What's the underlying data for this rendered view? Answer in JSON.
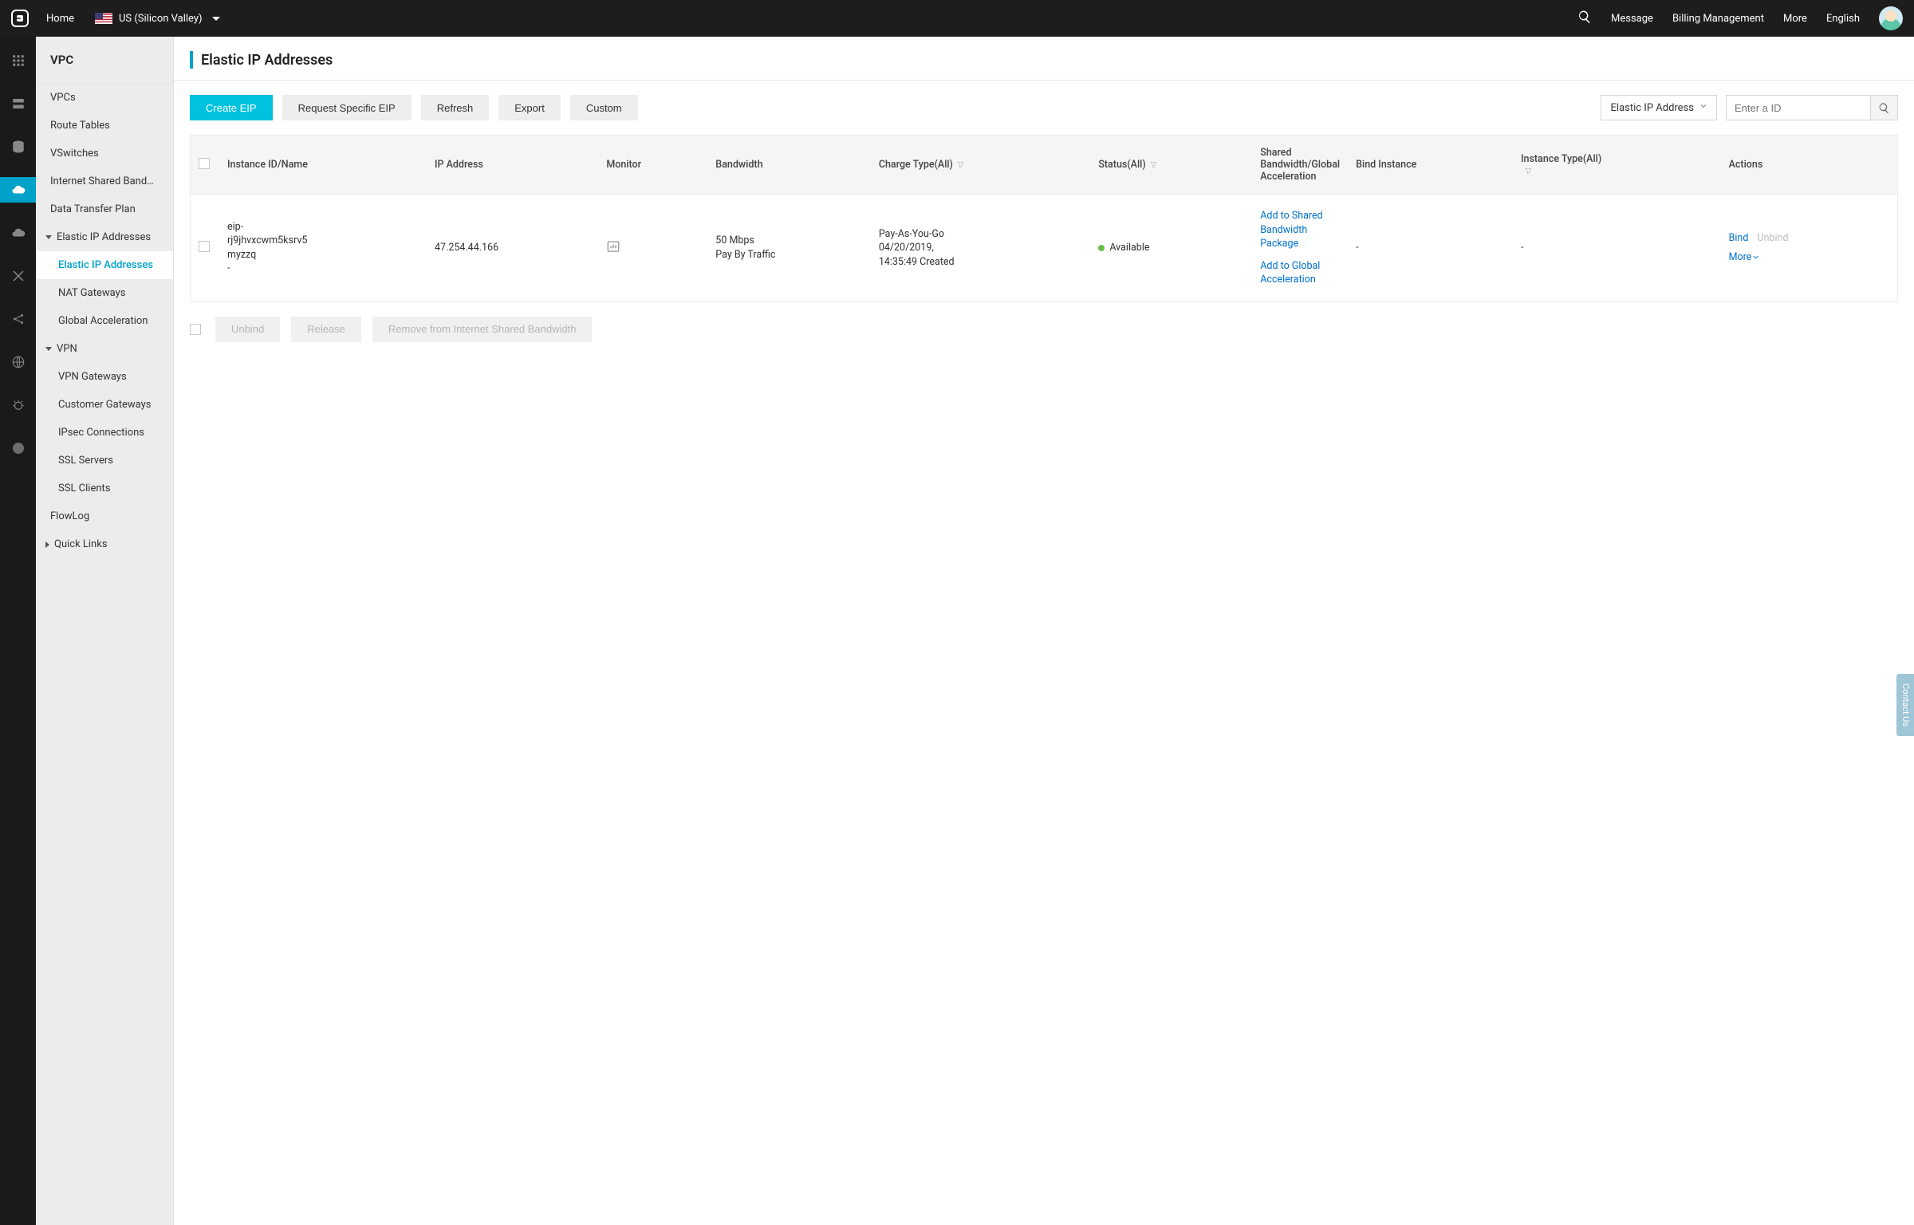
{
  "topbar": {
    "home": "Home",
    "region": "US (Silicon Valley)",
    "links": {
      "message": "Message",
      "billing": "Billing Management",
      "more": "More",
      "lang": "English"
    }
  },
  "sidebar": {
    "title": "VPC",
    "items": [
      "VPCs",
      "Route Tables",
      "VSwitches",
      "Internet Shared Band…",
      "Data Transfer Plan"
    ],
    "eip_group": "Elastic IP Addresses",
    "eip_items": [
      "Elastic IP Addresses",
      "NAT Gateways",
      "Global Acceleration"
    ],
    "vpn_group": "VPN",
    "vpn_items": [
      "VPN Gateways",
      "Customer Gateways",
      "IPsec Connections",
      "SSL Servers",
      "SSL Clients"
    ],
    "flowlog": "FlowLog",
    "quick": "Quick Links"
  },
  "page": {
    "title": "Elastic IP Addresses",
    "buttons": {
      "create": "Create EIP",
      "request": "Request Specific EIP",
      "refresh": "Refresh",
      "export": "Export",
      "custom": "Custom"
    },
    "filter_label": "Elastic IP Address",
    "search_placeholder": "Enter a ID"
  },
  "table": {
    "headers": {
      "instance": "Instance ID/Name",
      "ip": "IP Address",
      "monitor": "Monitor",
      "bandwidth": "Bandwidth",
      "charge": "Charge Type(All)",
      "status": "Status(All)",
      "shared": "Shared Bandwidth/Global Acceleration",
      "bindinst": "Bind Instance",
      "insttype": "Instance Type(All)",
      "actions": "Actions"
    },
    "row": {
      "id_line1": "eip-",
      "id_line2": "rj9jhvxcwm5ksrv5",
      "id_line3": "myzzq",
      "id_line4": "-",
      "ip": "47.254.44.166",
      "bw1": "50 Mbps",
      "bw2": "Pay By Traffic",
      "charge1": "Pay-As-You-Go",
      "charge2": "04/20/2019,",
      "charge3": "14:35:49 Created",
      "status": "Available",
      "shared1": "Add to Shared Bandwidth Package",
      "shared2": "Add to Global Acceleration",
      "bindinst": "-",
      "insttype": "-",
      "act_bind": "Bind",
      "act_unbind": "Unbind",
      "act_more": "More"
    }
  },
  "bulk": {
    "unbind": "Unbind",
    "release": "Release",
    "remove": "Remove from Internet Shared Bandwidth"
  },
  "contact": "Contact Us"
}
